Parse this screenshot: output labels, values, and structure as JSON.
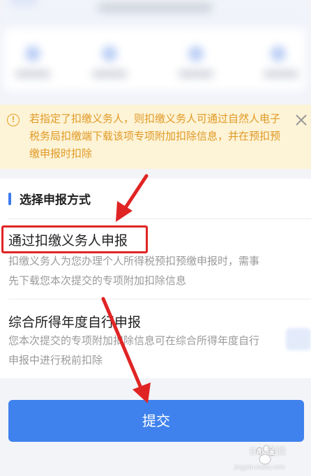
{
  "banner": {
    "text": "若指定了扣缴义务人，则扣缴义务人可通过自然人电子税务局扣缴端下载该项专项附加扣除信息，并在预扣预缴申报时扣除",
    "color": "#e09a25",
    "background": "#fdf3d6"
  },
  "section": {
    "title": "选择申报方式",
    "accent": "#3d7bef"
  },
  "options": [
    {
      "title": "通过扣缴义务人申报",
      "desc": "扣缴义务人为您办理个人所得税预扣预缴申报时，需事先下载您本次提交的专项附加扣除信息"
    },
    {
      "title": "综合所得年度自行申报",
      "desc": "您本次提交的专项附加扣除信息可在综合所得年度自行申报中进行税前扣除"
    }
  ],
  "submit": {
    "label": "提交",
    "color": "#3f82ee"
  },
  "annotation": {
    "highlight_color": "#e02424"
  },
  "watermark": {
    "text": "Bai  经验",
    "sub": "jingyan.baidu.com"
  }
}
